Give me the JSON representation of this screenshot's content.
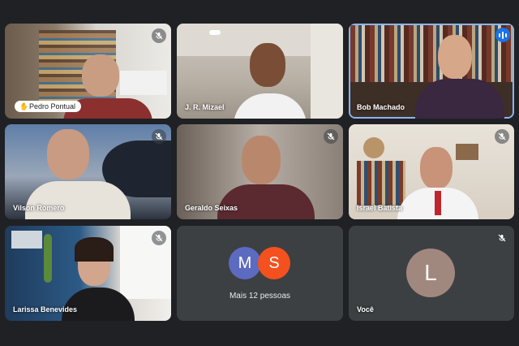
{
  "participants": [
    {
      "name": "Pedro Pontual",
      "hand_raised": true,
      "muted": true
    },
    {
      "name": "J. R. Mizael",
      "muted": false
    },
    {
      "name": "Bob Machado",
      "speaking": true
    },
    {
      "name": "Vilson Romero",
      "muted": true
    },
    {
      "name": "Geraldo Seixas",
      "muted": true
    },
    {
      "name": "Israel Batista",
      "muted": true
    },
    {
      "name": "Larissa Benevides",
      "muted": true
    },
    {
      "name": "Você",
      "initial": "L",
      "muted": true
    }
  ],
  "more": {
    "label": "Mais 12 pessoas",
    "avatars": [
      {
        "initial": "M",
        "color": "#5c6bc0"
      },
      {
        "initial": "S",
        "color": "#f4511e"
      }
    ]
  },
  "colors": {
    "background": "#202124",
    "speaking_border": "#8ab4f8",
    "self_avatar": "#a1887f"
  },
  "icons": {
    "mute": "mic-off-icon",
    "hand": "raised-hand-icon",
    "speaking": "audio-level-icon"
  }
}
